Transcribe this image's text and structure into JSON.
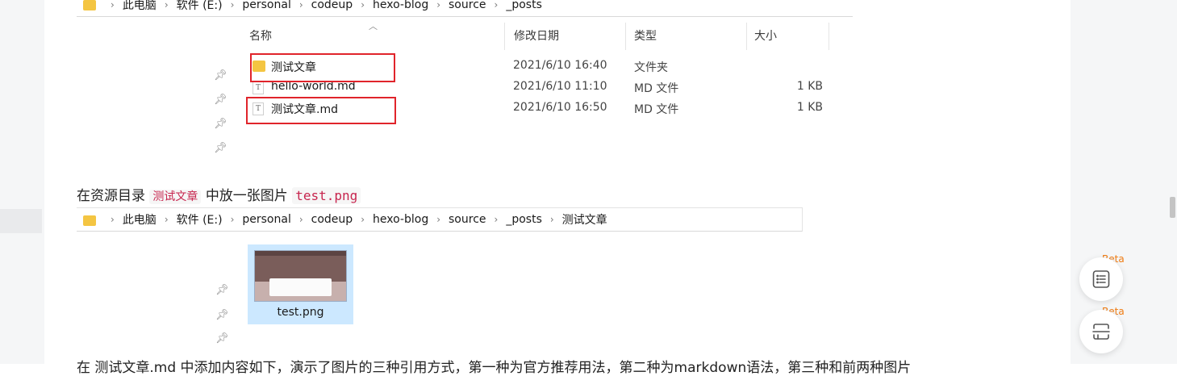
{
  "explorer_top": {
    "breadcrumb": [
      "此电脑",
      "软件 (E:)",
      "personal",
      "codeup",
      "hexo-blog",
      "source",
      "_posts"
    ],
    "columns": {
      "name": "名称",
      "date": "修改日期",
      "type": "类型",
      "size": "大小"
    },
    "files": [
      {
        "name": "测试文章",
        "date": "2021/6/10 16:40",
        "type": "文件夹",
        "size": "",
        "icon": "folder-icon"
      },
      {
        "name": "hello-world.md",
        "date": "2021/6/10 11:10",
        "type": "MD 文件",
        "size": "1 KB",
        "icon": "text-file-icon"
      },
      {
        "name": "测试文章.md",
        "date": "2021/6/10 16:50",
        "type": "MD 文件",
        "size": "1 KB",
        "icon": "text-file-icon"
      }
    ]
  },
  "paragraph1": {
    "prefix": "在资源目录",
    "folder_code": "测试文章",
    "middle": "中放一张图片",
    "file_code": "test.png"
  },
  "explorer_bottom": {
    "breadcrumb": [
      "此电脑",
      "软件 (E:)",
      "personal",
      "codeup",
      "hexo-blog",
      "source",
      "_posts",
      "测试文章"
    ],
    "thumbnail_label": "test.png"
  },
  "paragraph2": {
    "text": "在 测试文章.md 中添加内容如下，演示了图片的三种引用方式，第一种为官方推荐用法，第二种为markdown语法，第三种和前两种图片"
  },
  "sidebar_right": {
    "beta1": "Beta",
    "beta2": "Beta"
  }
}
